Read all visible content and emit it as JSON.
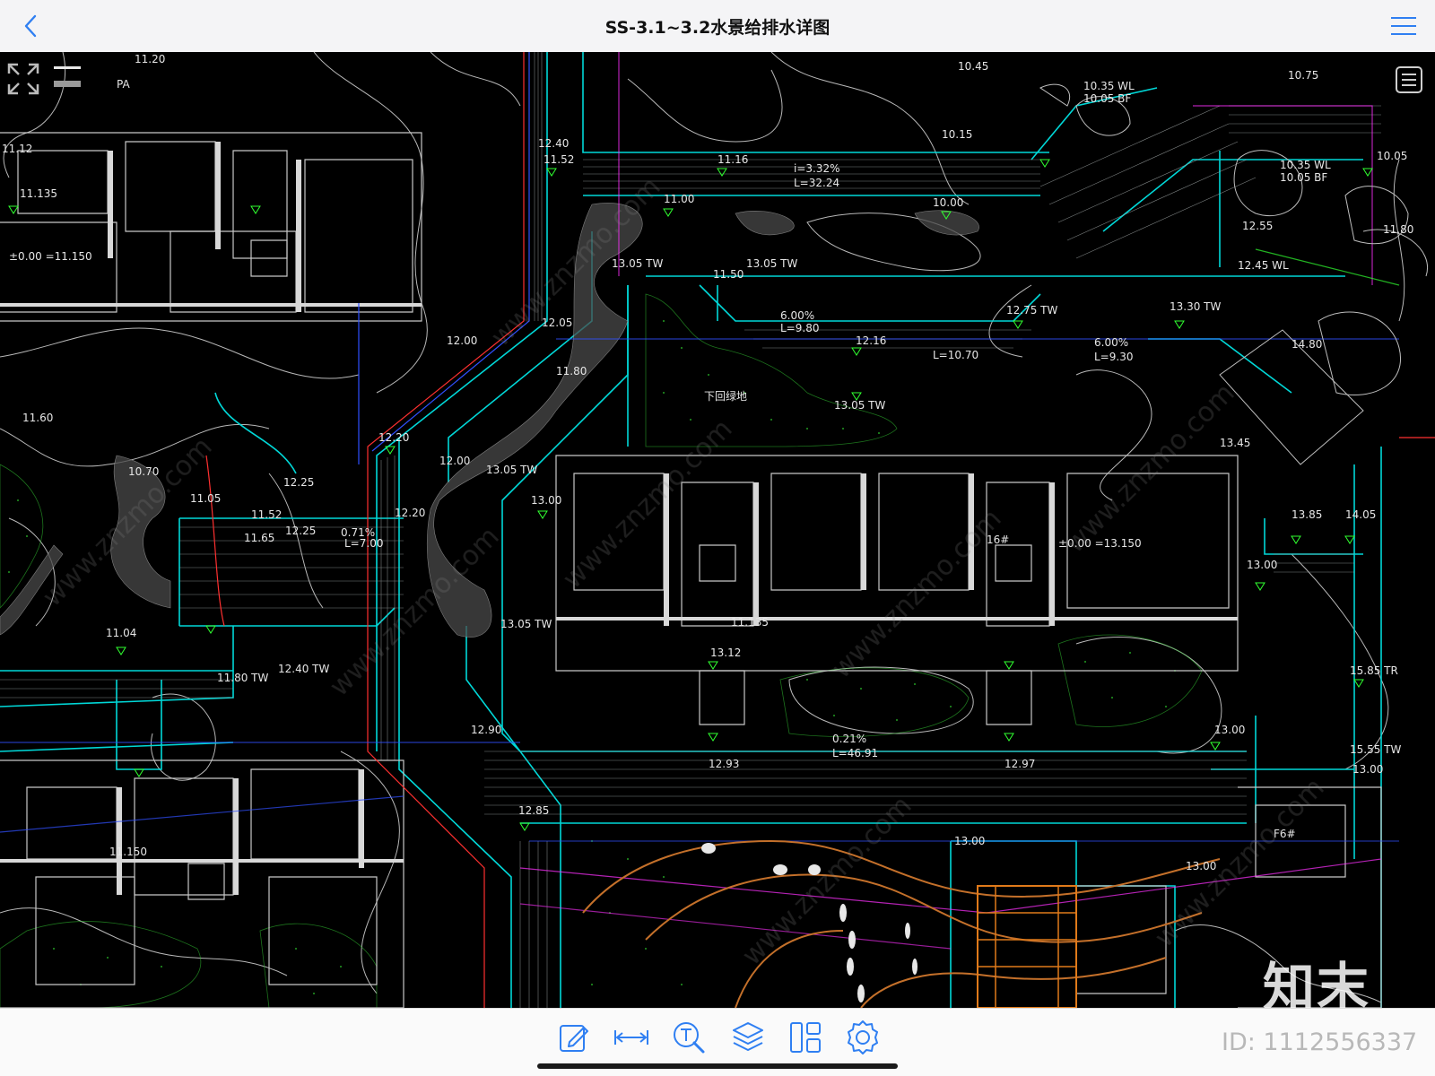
{
  "header": {
    "title": "SS-3.1~3.2水景给排水详图"
  },
  "drawing": {
    "labels": [
      "11.20",
      "PA",
      "11.12",
      "11.135",
      "±0.00 =11.150",
      "11.60",
      "12.00",
      "12.40",
      "10.70",
      "11.05",
      "12.25",
      "11.65",
      "12.25",
      "0.71%",
      "L=7.00",
      "12.20",
      "11.04",
      "12.40 TW",
      "11.80 TW",
      "11.150",
      "11.52",
      "11.16",
      "i=3.32%",
      "L=32.24",
      "11.00",
      "10.00",
      "13.05 TW",
      "11.50",
      "13.05 TW",
      "6.00%",
      "L=9.80",
      "12.75 TW",
      "12.16",
      "L=10.70",
      "6.00%",
      "L=9.30",
      "13.30 TW",
      "12.45 WL",
      "13.05 TW",
      "下回绿地",
      "12.20",
      "12.00",
      "13.05 TW",
      "13.00",
      "±0.00 =13.150",
      "11.135",
      "13.12",
      "13.05 TW",
      "12.90",
      "12.93",
      "0.21%",
      "L=46.91",
      "12.97",
      "13.00",
      "12.85",
      "13.00",
      "10.45",
      "10.35 WL",
      "10.05 BF",
      "10.35 WL",
      "10.05 BF",
      "14.80",
      "13.85",
      "14.05",
      "15.85 TR",
      "15.55 TW",
      "12.55",
      "13.45",
      "13.00",
      "16#",
      "F6#",
      "13.00",
      "13.00",
      "11.80",
      "10.75",
      "10.05",
      "10.15",
      "11.52",
      "12.05",
      "11.80"
    ],
    "layer_colors": {
      "contour": "#e8e8e8",
      "path": "#00e5e5",
      "red": "#ff3030",
      "blue": "#3050ff",
      "green": "#30ff30",
      "magenta": "#ff30ff",
      "orange": "#d0782a",
      "yellow": "#ffe030"
    }
  },
  "overlay": {
    "fullscreen_icon": "expand-icon",
    "layers_list_icon": "list-icon"
  },
  "toolbar": {
    "tools": [
      {
        "name": "edit-icon"
      },
      {
        "name": "measure-icon"
      },
      {
        "name": "text-search-icon"
      },
      {
        "name": "layers-icon"
      },
      {
        "name": "layout-icon"
      },
      {
        "name": "settings-icon"
      }
    ]
  },
  "watermark": {
    "brand": "知末",
    "id_text": "ID: 1112556337"
  }
}
